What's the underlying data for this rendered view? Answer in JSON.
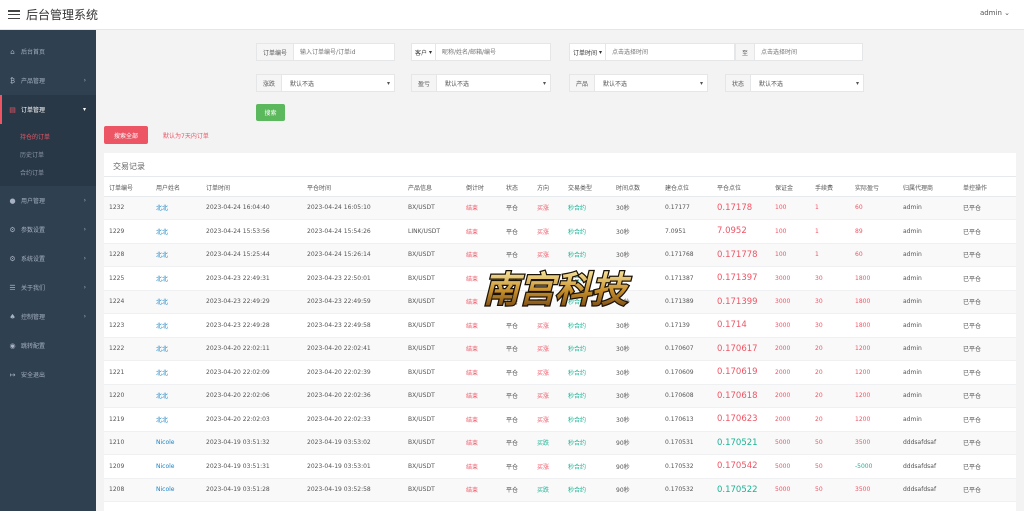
{
  "app": {
    "title": "后台管理系统",
    "user": "admin"
  },
  "sidebar": {
    "items": [
      {
        "label": "后台首页",
        "icon": "home-icon",
        "glyph": "⌂"
      },
      {
        "label": "产品管理",
        "icon": "bitcoin-icon",
        "glyph": "₿"
      },
      {
        "label": "订单管理",
        "icon": "order-icon",
        "glyph": "▤"
      },
      {
        "label": "用户管理",
        "icon": "user-icon",
        "glyph": "●"
      },
      {
        "label": "参数设置",
        "icon": "settings-icon",
        "glyph": "⚙"
      },
      {
        "label": "系统设置",
        "icon": "gears-icon",
        "glyph": "⚙"
      },
      {
        "label": "关于我们",
        "icon": "list-icon",
        "glyph": "☰"
      },
      {
        "label": "控制管理",
        "icon": "control-icon",
        "glyph": "♠"
      },
      {
        "label": "跳转配置",
        "icon": "redirect-icon",
        "glyph": "◉"
      },
      {
        "label": "安全退出",
        "icon": "logout-icon",
        "glyph": "↦"
      }
    ],
    "sub_items": [
      "持仓的订单",
      "历史订单",
      "合约订单"
    ]
  },
  "filters": {
    "order_label": "订单编号",
    "order_placeholder": "输入订单编号/订单id",
    "customer_select": "客户",
    "customer_placeholder": "昵称/姓名/邮箱/编号",
    "time_select": "订单时间",
    "start_placeholder": "点击选择时间",
    "to_label": "至",
    "end_placeholder": "点击选择时间",
    "direction_label": "涨跌",
    "direction_value": "默认不选",
    "pl_label": "盈亏",
    "pl_value": "默认不选",
    "product_label": "产品",
    "product_value": "默认不选",
    "status_label": "状态",
    "status_value": "默认不选",
    "search_button": "搜索",
    "all_button": "搜索全部",
    "note": "默认为7天内订单"
  },
  "table": {
    "title": "交易记录",
    "headers": [
      "订单编号",
      "用户姓名",
      "订单时间",
      "平仓时间",
      "产品信息",
      "倒计时",
      "状态",
      "方向",
      "交易类型",
      "时间点数",
      "建仓点位",
      "平仓点位",
      "保证金",
      "手续费",
      "实际盈亏",
      "归属代理商",
      "单控操作"
    ],
    "rows": [
      [
        "1232",
        "北北",
        "2023-04-24 16:04:40",
        "2023-04-24 16:05:10",
        "BX/USDT",
        "结束",
        "平仓",
        "买涨",
        "秒合约",
        "30秒",
        "0.17177",
        "0.17178",
        "100",
        "1",
        "60",
        "admin",
        "已平仓"
      ],
      [
        "1229",
        "北北",
        "2023-04-24 15:53:56",
        "2023-04-24 15:54:26",
        "LINK/USDT",
        "结束",
        "平仓",
        "买涨",
        "秒合约",
        "30秒",
        "7.0951",
        "7.0952",
        "100",
        "1",
        "89",
        "admin",
        "已平仓"
      ],
      [
        "1228",
        "北北",
        "2023-04-24 15:25:44",
        "2023-04-24 15:26:14",
        "BX/USDT",
        "结束",
        "平仓",
        "买涨",
        "秒合约",
        "30秒",
        "0.171768",
        "0.171778",
        "100",
        "1",
        "60",
        "admin",
        "已平仓"
      ],
      [
        "1225",
        "北北",
        "2023-04-23 22:49:31",
        "2023-04-23 22:50:01",
        "BX/USDT",
        "结束",
        "平仓",
        "买涨",
        "秒合约",
        "30秒",
        "0.171387",
        "0.171397",
        "3000",
        "30",
        "1800",
        "admin",
        "已平仓"
      ],
      [
        "1224",
        "北北",
        "2023-04-23 22:49:29",
        "2023-04-23 22:49:59",
        "BX/USDT",
        "结束",
        "平仓",
        "买涨",
        "秒合约",
        "30秒",
        "0.171389",
        "0.171399",
        "3000",
        "30",
        "1800",
        "admin",
        "已平仓"
      ],
      [
        "1223",
        "北北",
        "2023-04-23 22:49:28",
        "2023-04-23 22:49:58",
        "BX/USDT",
        "结束",
        "平仓",
        "买涨",
        "秒合约",
        "30秒",
        "0.17139",
        "0.1714",
        "3000",
        "30",
        "1800",
        "admin",
        "已平仓"
      ],
      [
        "1222",
        "北北",
        "2023-04-20 22:02:11",
        "2023-04-20 22:02:41",
        "BX/USDT",
        "结束",
        "平仓",
        "买涨",
        "秒合约",
        "30秒",
        "0.170607",
        "0.170617",
        "2000",
        "20",
        "1200",
        "admin",
        "已平仓"
      ],
      [
        "1221",
        "北北",
        "2023-04-20 22:02:09",
        "2023-04-20 22:02:39",
        "BX/USDT",
        "结束",
        "平仓",
        "买涨",
        "秒合约",
        "30秒",
        "0.170609",
        "0.170619",
        "2000",
        "20",
        "1200",
        "admin",
        "已平仓"
      ],
      [
        "1220",
        "北北",
        "2023-04-20 22:02:06",
        "2023-04-20 22:02:36",
        "BX/USDT",
        "结束",
        "平仓",
        "买涨",
        "秒合约",
        "30秒",
        "0.170608",
        "0.170618",
        "2000",
        "20",
        "1200",
        "admin",
        "已平仓"
      ],
      [
        "1219",
        "北北",
        "2023-04-20 22:02:03",
        "2023-04-20 22:02:33",
        "BX/USDT",
        "结束",
        "平仓",
        "买涨",
        "秒合约",
        "30秒",
        "0.170613",
        "0.170623",
        "2000",
        "20",
        "1200",
        "admin",
        "已平仓"
      ],
      [
        "1210",
        "Nicole",
        "2023-04-19 03:51:32",
        "2023-04-19 03:53:02",
        "BX/USDT",
        "结束",
        "平仓",
        "买跌",
        "秒合约",
        "90秒",
        "0.170531",
        "0.170521",
        "5000",
        "50",
        "3500",
        "dddsafdsaf",
        "已平仓"
      ],
      [
        "1209",
        "Nicole",
        "2023-04-19 03:51:31",
        "2023-04-19 03:53:01",
        "BX/USDT",
        "结束",
        "平仓",
        "买涨",
        "秒合约",
        "90秒",
        "0.170532",
        "0.170542",
        "5000",
        "50",
        "-5000",
        "dddsafdsaf",
        "已平仓"
      ],
      [
        "1208",
        "Nicole",
        "2023-04-19 03:51:28",
        "2023-04-19 03:52:58",
        "BX/USDT",
        "结束",
        "平仓",
        "买跌",
        "秒合约",
        "90秒",
        "0.170532",
        "0.170522",
        "5000",
        "50",
        "3500",
        "dddsafdsaf",
        "已平仓"
      ]
    ]
  },
  "watermark": {
    "text": "南宫科技"
  },
  "colors": {
    "sidebar": "#2f4050",
    "accent_red": "#ed5565",
    "accent_green": "#1ab394",
    "button_green": "#5cb85c",
    "link_blue": "#1c84c6"
  }
}
